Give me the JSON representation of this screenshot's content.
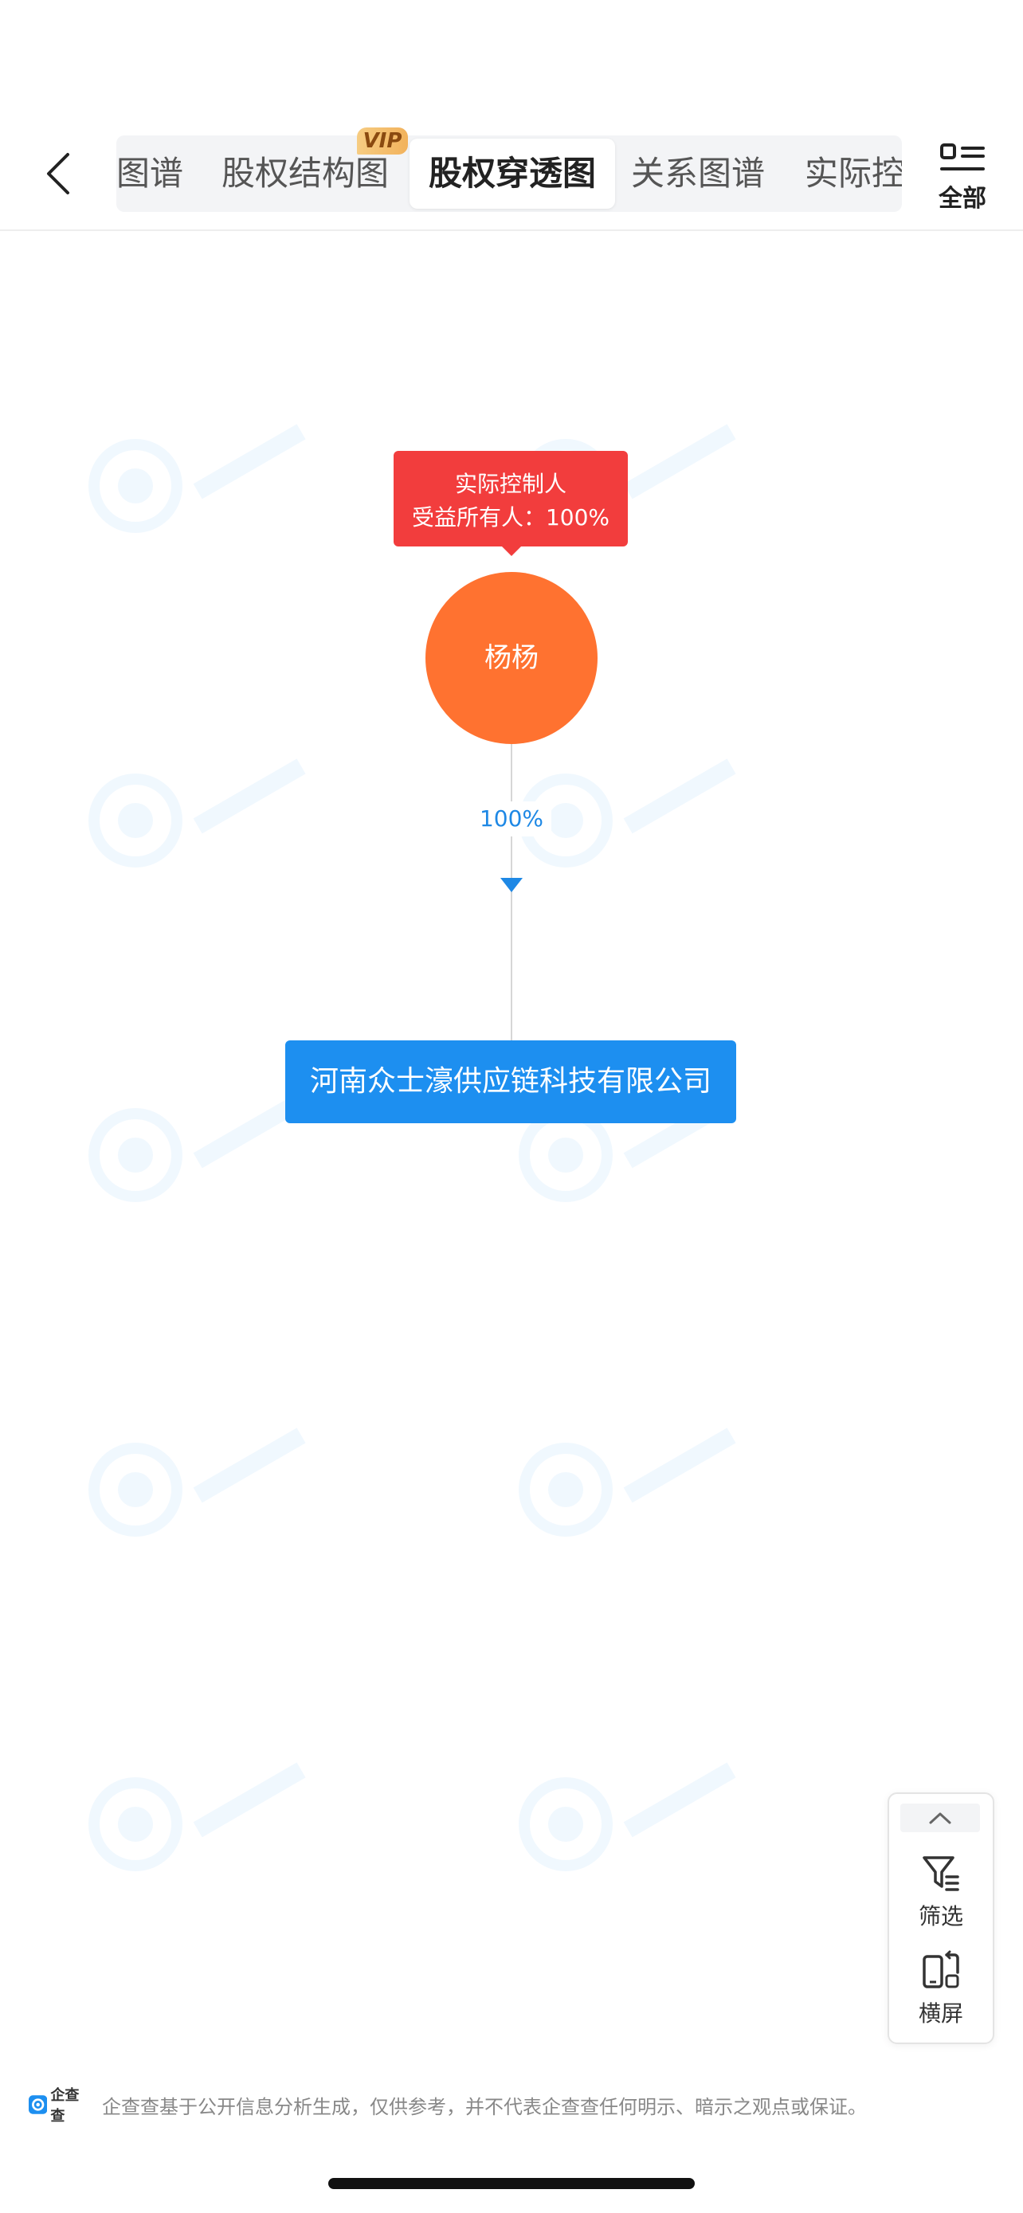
{
  "header": {
    "tabs": [
      {
        "label": "图谱",
        "active": false
      },
      {
        "label": "股权结构图",
        "active": false,
        "badge": "VIP"
      },
      {
        "label": "股权穿透图",
        "active": true
      },
      {
        "label": "关系图谱",
        "active": false
      },
      {
        "label": "实际控",
        "active": false
      }
    ],
    "all_label": "全部",
    "icons": {
      "back": "chevron-left-icon",
      "all": "grid-menu-icon"
    }
  },
  "chart": {
    "controller_tag_line1": "实际控制人",
    "controller_tag_line2": "受益所有人：100%",
    "person_name": "杨杨",
    "edge_percent": "100%",
    "company_name": "河南众士濠供应链科技有限公司",
    "colors": {
      "tag": "#f23d3d",
      "person": "#ff7230",
      "company": "#1d8ff0",
      "edge_label": "#1e88e5"
    }
  },
  "side_tools": {
    "filter_label": "筛选",
    "landscape_label": "横屏",
    "icons": {
      "collapse": "chevron-up-icon",
      "filter": "filter-icon",
      "landscape": "rotate-screen-icon"
    }
  },
  "footer": {
    "brand": "企查查",
    "disclaimer": "企查查基于公开信息分析生成，仅供参考，并不代表企查查任何明示、暗示之观点或保证。"
  }
}
